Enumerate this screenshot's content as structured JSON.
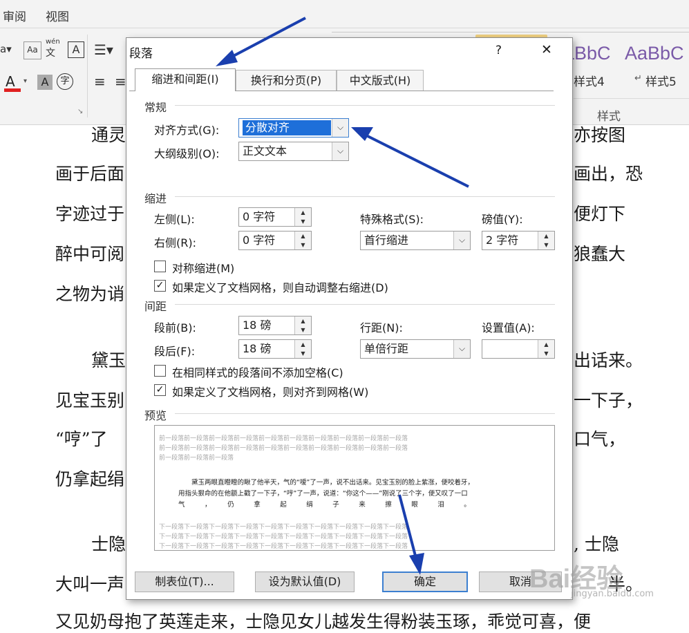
{
  "ribbon": {
    "tabs": [
      "审阅",
      "视图"
    ],
    "style_samples": [
      "aBbC",
      "AaBbC"
    ],
    "style_names": [
      "样式4",
      "样式5"
    ],
    "group_label": "样式",
    "font_color_label": "A",
    "char_shading_label": "A",
    "phonetic_label": "wén"
  },
  "document": {
    "lines": [
      "通灵",
      "画于后面",
      "字迹过于",
      "醉中可阅",
      "之物为诮",
      "黛玉",
      "见宝玉别",
      "“哼”了",
      "仍拿起绢",
      "士隐",
      "大叫一声",
      "又见奶母抱了英莲走来，士隐见女儿越发生得粉装玉琢，乖觉可喜，便"
    ],
    "right_lines": [
      "亦按图",
      "画出，恐",
      "便灯下",
      "狼蠢大",
      "出话来。",
      "一下子，",
      "口气，",
      ", 士隐",
      "半。"
    ]
  },
  "dialog": {
    "title": "段落",
    "help": "?",
    "close": "✕",
    "tabs": [
      "缩进和间距(I)",
      "换行和分页(P)",
      "中文版式(H)"
    ],
    "general": {
      "section": "常规",
      "alignment_label": "对齐方式(G):",
      "alignment_value": "分散对齐",
      "outline_label": "大纲级别(O):",
      "outline_value": "正文文本"
    },
    "indent": {
      "section": "缩进",
      "left_label": "左侧(L):",
      "left_value": "0 字符",
      "right_label": "右侧(R):",
      "right_value": "0 字符",
      "special_label": "特殊格式(S):",
      "special_value": "首行缩进",
      "by_label": "磅值(Y):",
      "by_value": "2 字符",
      "mirror_label": "对称缩进(M)",
      "mirror_checked": false,
      "auto_adjust_label": "如果定义了文档网格，则自动调整右缩进(D)",
      "auto_adjust_checked": true
    },
    "spacing": {
      "section": "间距",
      "before_label": "段前(B):",
      "before_value": "18 磅",
      "after_label": "段后(F):",
      "after_value": "18 磅",
      "line_label": "行距(N):",
      "line_value": "单倍行距",
      "at_label": "设置值(A):",
      "at_value": "",
      "no_space_label": "在相同样式的段落间不添加空格(C)",
      "no_space_checked": false,
      "snap_grid_label": "如果定义了文档网格，则对齐到网格(W)",
      "snap_grid_checked": true
    },
    "preview": {
      "section": "预览",
      "prev_lines": [
        "前一段落前一段落前一段落前一段落前一段落前一段落前一段落前一段落前一段落前一段落",
        "前一段落前一段落前一段落前一段落前一段落前一段落前一段落前一段落前一段落前一段落",
        "前一段落前一段落前一段落"
      ],
      "main_lines": [
        "　　黛玉两眼直瞪瞪的瞅了他半天，气的“嗳”了一声，说不出话来。见宝玉别的脸上紫涨，便咬着牙，",
        "用指头狠命的在他额上戳了一下子，“哼”了一声，说道：“你这个——”刚说了三个字，便又叹了一口",
        "气　　　，　　　仍　　　拿　　　起　　　绢　　　子　　　来　　　擦　　　眼　　　泪　　　。"
      ],
      "next_lines": [
        "下一段落下一段落下一段落下一段落下一段落下一段落下一段落下一段落下一段落下一段落",
        "下一段落下一段落下一段落下一段落下一段落下一段落下一段落下一段落下一段落下一段落",
        "下一段落下一段落下一段落下一段落下一段落下一段落下一段落下一段落下一段落下一段落",
        "下一段落下一段落下一段落下一段落下一段落下一段落下一段落下一段落下一段落下一段落"
      ]
    },
    "buttons": {
      "tabs": "制表位(T)...",
      "set_default": "设为默认值(D)",
      "ok": "确定",
      "cancel": "取消"
    }
  },
  "watermark": {
    "brand": "Bai经验",
    "url": "jingyan.baidu.com"
  },
  "colors": {
    "arrow": "#1a3fae",
    "selection": "#1e6fd9",
    "style_sample": "#7a5aa8",
    "font_color_red": "#e02020"
  }
}
